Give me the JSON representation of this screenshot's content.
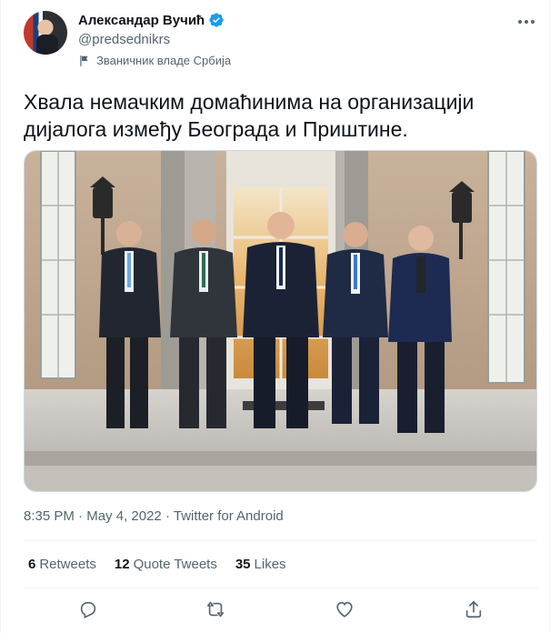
{
  "author": {
    "name": "Александар Вучић",
    "handle": "@predsednikrs",
    "label": "Званичник владе Србија"
  },
  "icons": {
    "verified": "verified-badge-icon",
    "label": "flag-icon",
    "more": "more-horizontal-icon",
    "reply": "reply-icon",
    "retweet": "retweet-icon",
    "like": "like-icon",
    "share": "share-icon"
  },
  "tweet": {
    "text_line1": "Хвала немачким домаћинима на организацији",
    "text_line2": "дијалога између Београда и Приштине.",
    "time": "8:35 PM",
    "separator": "·",
    "date": "May 4, 2022",
    "source": "Twitter for Android"
  },
  "stats": {
    "retweets_count": "6",
    "retweets_label": "Retweets",
    "quotes_count": "12",
    "quotes_label": "Quote Tweets",
    "likes_count": "35",
    "likes_label": "Likes"
  },
  "colors": {
    "accent": "#1d9bf0",
    "secondary_text": "#536471"
  }
}
